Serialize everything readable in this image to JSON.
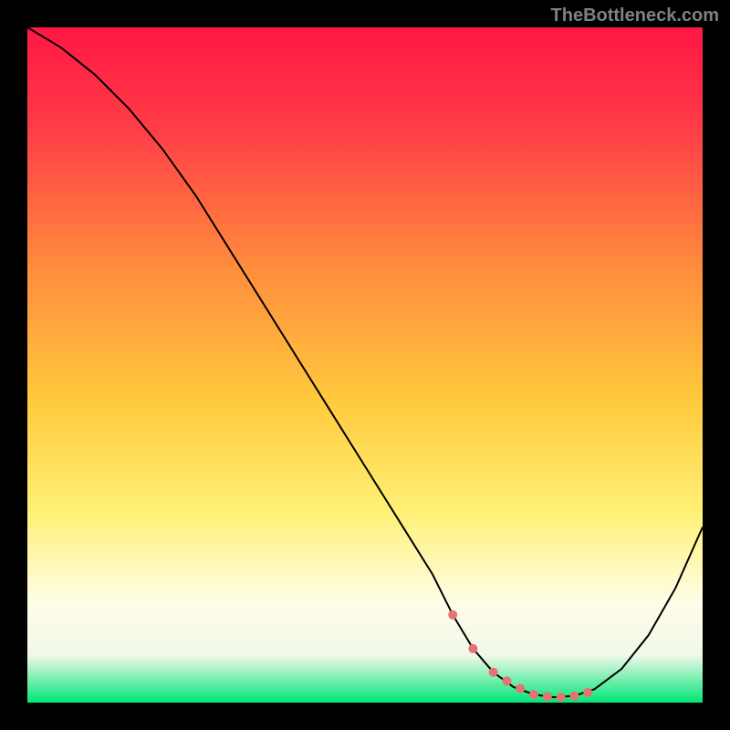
{
  "watermark": "TheBottleneck.com",
  "chart_data": {
    "type": "line",
    "title": "",
    "xlabel": "",
    "ylabel": "",
    "xlim": [
      0,
      100
    ],
    "ylim": [
      0,
      100
    ],
    "background": {
      "type": "vertical-gradient",
      "stops": [
        {
          "offset": 0,
          "color": "#ff1744"
        },
        {
          "offset": 15,
          "color": "#ff3d47"
        },
        {
          "offset": 35,
          "color": "#ff8a3d"
        },
        {
          "offset": 55,
          "color": "#ffc93d"
        },
        {
          "offset": 72,
          "color": "#fff176"
        },
        {
          "offset": 85,
          "color": "#fffde7"
        },
        {
          "offset": 93,
          "color": "#f1f8e9"
        },
        {
          "offset": 100,
          "color": "#00e676"
        }
      ]
    },
    "series": [
      {
        "name": "bottleneck-curve",
        "color": "#000000",
        "stroke_width": 2,
        "x": [
          0,
          5,
          10,
          15,
          20,
          25,
          30,
          35,
          40,
          45,
          50,
          55,
          60,
          63,
          66,
          69,
          72,
          75,
          78,
          81,
          84,
          88,
          92,
          96,
          100
        ],
        "values": [
          100,
          97,
          93,
          88,
          82,
          75,
          67,
          59,
          51,
          43,
          35,
          27,
          19,
          13,
          8,
          4.5,
          2.3,
          1.2,
          0.8,
          1.0,
          2.0,
          5.0,
          10,
          17,
          26
        ]
      }
    ],
    "highlight_region": {
      "name": "optimal-zone-dots",
      "color": "#e57373",
      "dot_radius": 5,
      "x": [
        63,
        66,
        69,
        71,
        73,
        75,
        77,
        79,
        81,
        83
      ],
      "values": [
        13,
        8,
        4.5,
        3.2,
        2.1,
        1.2,
        0.9,
        0.8,
        1.0,
        1.5
      ]
    }
  }
}
